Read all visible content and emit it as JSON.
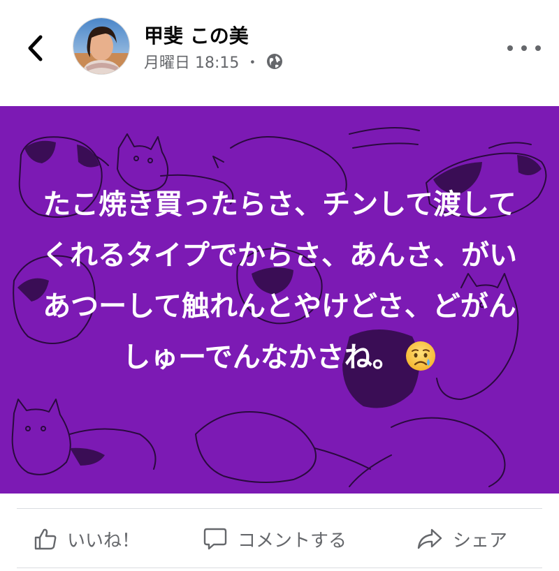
{
  "header": {
    "back_icon": "chevron-left-icon",
    "author_name": "甲斐 この美",
    "timestamp": "月曜日 18:15",
    "separator": "・",
    "privacy_icon": "globe-icon",
    "more_icon": "ellipsis-icon"
  },
  "post": {
    "background_color": "#7c1ab4",
    "background_pattern": "cats-illustration",
    "text": "たこ焼き買ったらさ、チンして渡してくれるタイプでからさ、あんさ、がいあつーして触れんとやけどさ、どがんしゅーでんなかさね。",
    "emoji": "crying-face"
  },
  "actions": {
    "like_label": "いいね！",
    "comment_label": "コメントする",
    "share_label": "シェア",
    "like_icon": "thumbs-up-icon",
    "comment_icon": "speech-bubble-icon",
    "share_icon": "share-arrow-icon"
  },
  "colors": {
    "accent_purple": "#7c1ab4",
    "secondary_text": "#65676b",
    "primary_text": "#050505"
  }
}
